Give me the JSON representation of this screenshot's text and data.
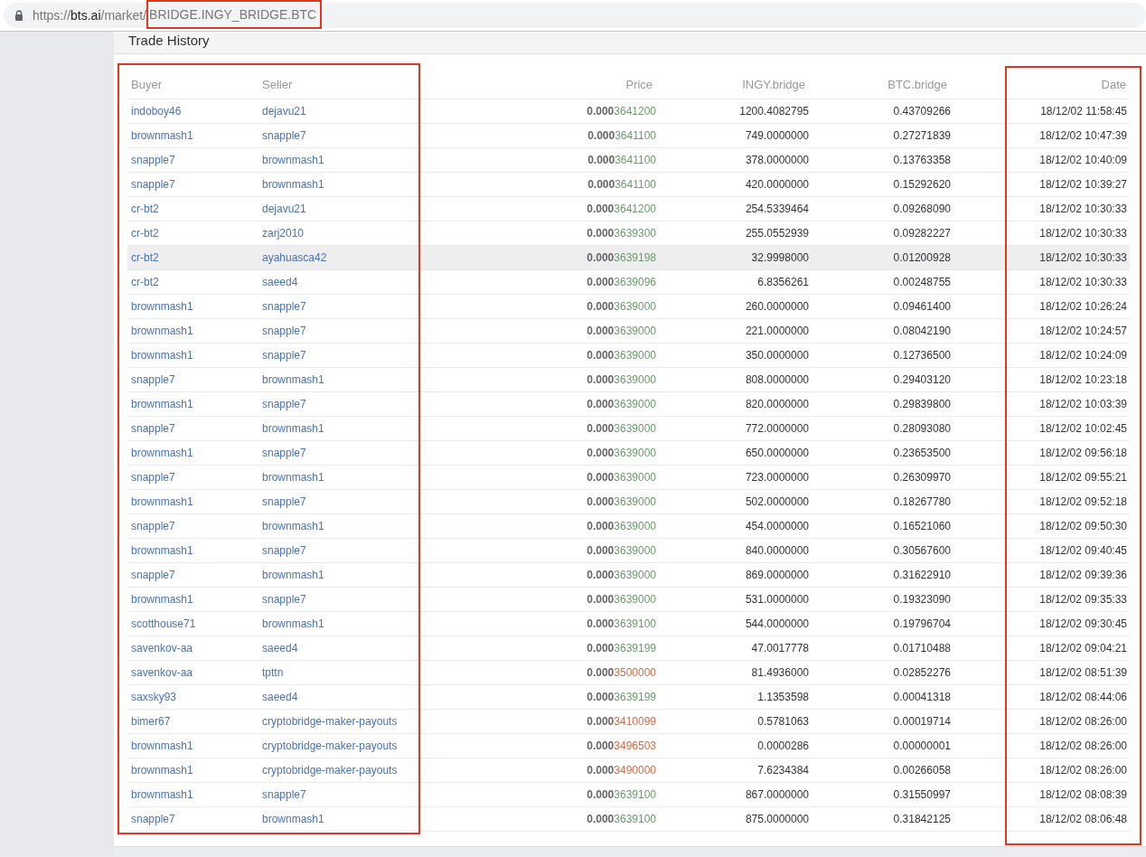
{
  "address_bar": {
    "scheme": "https://",
    "domain": "bts.ai",
    "path": "/market/",
    "market": "BRIDGE.INGY_BRIDGE.BTC",
    "market_highlighted": true
  },
  "panel": {
    "title": "Trade History"
  },
  "table": {
    "columns": [
      "Buyer",
      "Seller",
      "Price",
      "INGY.bridge",
      "BTC.bridge",
      "Date"
    ],
    "parties_outlined": true,
    "date_outlined": true,
    "rows": [
      {
        "buyer": "indoboy46",
        "seller": "dejavu21",
        "price_prefix": "0.000",
        "price_digits": "3641200",
        "color": "#6c9a6c",
        "amount": "1200.4082795",
        "total": "0.43709266",
        "date": "18/12/02 11:58:45",
        "highlighted": false
      },
      {
        "buyer": "brownmash1",
        "seller": "snapple7",
        "price_prefix": "0.000",
        "price_digits": "3641100",
        "color": "#6c9a6c",
        "amount": "749.0000000",
        "total": "0.27271839",
        "date": "18/12/02 10:47:39",
        "highlighted": false
      },
      {
        "buyer": "snapple7",
        "seller": "brownmash1",
        "price_prefix": "0.000",
        "price_digits": "3641100",
        "color": "#6c9a6c",
        "amount": "378.0000000",
        "total": "0.13763358",
        "date": "18/12/02 10:40:09",
        "highlighted": false
      },
      {
        "buyer": "snapple7",
        "seller": "brownmash1",
        "price_prefix": "0.000",
        "price_digits": "3641100",
        "color": "#6c9a6c",
        "amount": "420.0000000",
        "total": "0.15292620",
        "date": "18/12/02 10:39:27",
        "highlighted": false
      },
      {
        "buyer": "cr-bt2",
        "seller": "dejavu21",
        "price_prefix": "0.000",
        "price_digits": "3641200",
        "color": "#6c9a6c",
        "amount": "254.5339464",
        "total": "0.09268090",
        "date": "18/12/02 10:30:33",
        "highlighted": false
      },
      {
        "buyer": "cr-bt2",
        "seller": "zarj2010",
        "price_prefix": "0.000",
        "price_digits": "3639300",
        "color": "#6c9a6c",
        "amount": "255.0552939",
        "total": "0.09282227",
        "date": "18/12/02 10:30:33",
        "highlighted": false
      },
      {
        "buyer": "cr-bt2",
        "seller": "ayahuasca42",
        "price_prefix": "0.000",
        "price_digits": "3639198",
        "color": "#6c9a6c",
        "amount": "32.9998000",
        "total": "0.01200928",
        "date": "18/12/02 10:30:33",
        "highlighted": true
      },
      {
        "buyer": "cr-bt2",
        "seller": "saeed4",
        "price_prefix": "0.000",
        "price_digits": "3639096",
        "color": "#6c9a6c",
        "amount": "6.8356261",
        "total": "0.00248755",
        "date": "18/12/02 10:30:33",
        "highlighted": false
      },
      {
        "buyer": "brownmash1",
        "seller": "snapple7",
        "price_prefix": "0.000",
        "price_digits": "3639000",
        "color": "#6c9a6c",
        "amount": "260.0000000",
        "total": "0.09461400",
        "date": "18/12/02 10:26:24",
        "highlighted": false
      },
      {
        "buyer": "brownmash1",
        "seller": "snapple7",
        "price_prefix": "0.000",
        "price_digits": "3639000",
        "color": "#6c9a6c",
        "amount": "221.0000000",
        "total": "0.08042190",
        "date": "18/12/02 10:24:57",
        "highlighted": false
      },
      {
        "buyer": "brownmash1",
        "seller": "snapple7",
        "price_prefix": "0.000",
        "price_digits": "3639000",
        "color": "#6c9a6c",
        "amount": "350.0000000",
        "total": "0.12736500",
        "date": "18/12/02 10:24:09",
        "highlighted": false
      },
      {
        "buyer": "snapple7",
        "seller": "brownmash1",
        "price_prefix": "0.000",
        "price_digits": "3639000",
        "color": "#6c9a6c",
        "amount": "808.0000000",
        "total": "0.29403120",
        "date": "18/12/02 10:23:18",
        "highlighted": false
      },
      {
        "buyer": "brownmash1",
        "seller": "snapple7",
        "price_prefix": "0.000",
        "price_digits": "3639000",
        "color": "#6c9a6c",
        "amount": "820.0000000",
        "total": "0.29839800",
        "date": "18/12/02 10:03:39",
        "highlighted": false
      },
      {
        "buyer": "snapple7",
        "seller": "brownmash1",
        "price_prefix": "0.000",
        "price_digits": "3639000",
        "color": "#6c9a6c",
        "amount": "772.0000000",
        "total": "0.28093080",
        "date": "18/12/02 10:02:45",
        "highlighted": false
      },
      {
        "buyer": "brownmash1",
        "seller": "snapple7",
        "price_prefix": "0.000",
        "price_digits": "3639000",
        "color": "#6c9a6c",
        "amount": "650.0000000",
        "total": "0.23653500",
        "date": "18/12/02 09:56:18",
        "highlighted": false
      },
      {
        "buyer": "snapple7",
        "seller": "brownmash1",
        "price_prefix": "0.000",
        "price_digits": "3639000",
        "color": "#6c9a6c",
        "amount": "723.0000000",
        "total": "0.26309970",
        "date": "18/12/02 09:55:21",
        "highlighted": false
      },
      {
        "buyer": "brownmash1",
        "seller": "snapple7",
        "price_prefix": "0.000",
        "price_digits": "3639000",
        "color": "#6c9a6c",
        "amount": "502.0000000",
        "total": "0.18267780",
        "date": "18/12/02 09:52:18",
        "highlighted": false
      },
      {
        "buyer": "snapple7",
        "seller": "brownmash1",
        "price_prefix": "0.000",
        "price_digits": "3639000",
        "color": "#6c9a6c",
        "amount": "454.0000000",
        "total": "0.16521060",
        "date": "18/12/02 09:50:30",
        "highlighted": false
      },
      {
        "buyer": "brownmash1",
        "seller": "snapple7",
        "price_prefix": "0.000",
        "price_digits": "3639000",
        "color": "#6c9a6c",
        "amount": "840.0000000",
        "total": "0.30567600",
        "date": "18/12/02 09:40:45",
        "highlighted": false
      },
      {
        "buyer": "snapple7",
        "seller": "brownmash1",
        "price_prefix": "0.000",
        "price_digits": "3639000",
        "color": "#6c9a6c",
        "amount": "869.0000000",
        "total": "0.31622910",
        "date": "18/12/02 09:39:36",
        "highlighted": false
      },
      {
        "buyer": "brownmash1",
        "seller": "snapple7",
        "price_prefix": "0.000",
        "price_digits": "3639000",
        "color": "#6c9a6c",
        "amount": "531.0000000",
        "total": "0.19323090",
        "date": "18/12/02 09:35:33",
        "highlighted": false
      },
      {
        "buyer": "scotthouse71",
        "seller": "brownmash1",
        "price_prefix": "0.000",
        "price_digits": "3639100",
        "color": "#6c9a6c",
        "amount": "544.0000000",
        "total": "0.19796704",
        "date": "18/12/02 09:30:45",
        "highlighted": false
      },
      {
        "buyer": "savenkov-aa",
        "seller": "saeed4",
        "price_prefix": "0.000",
        "price_digits": "3639199",
        "color": "#6c9a6c",
        "amount": "47.0017778",
        "total": "0.01710488",
        "date": "18/12/02 09:04:21",
        "highlighted": false
      },
      {
        "buyer": "savenkov-aa",
        "seller": "tpttn",
        "price_prefix": "0.000",
        "price_digits": "3500000",
        "color": "#d0694a",
        "amount": "81.4936000",
        "total": "0.02852276",
        "date": "18/12/02 08:51:39",
        "highlighted": false
      },
      {
        "buyer": "saxsky93",
        "seller": "saeed4",
        "price_prefix": "0.000",
        "price_digits": "3639199",
        "color": "#6c9a6c",
        "amount": "1.1353598",
        "total": "0.00041318",
        "date": "18/12/02 08:44:06",
        "highlighted": false
      },
      {
        "buyer": "bimer67",
        "seller": "cryptobridge-maker-payouts",
        "price_prefix": "0.000",
        "price_digits": "3410099",
        "color": "#d0694a",
        "amount": "0.5781063",
        "total": "0.00019714",
        "date": "18/12/02 08:26:00",
        "highlighted": false
      },
      {
        "buyer": "brownmash1",
        "seller": "cryptobridge-maker-payouts",
        "price_prefix": "0.000",
        "price_digits": "3496503",
        "color": "#d0694a",
        "amount": "0.0000286",
        "total": "0.00000001",
        "date": "18/12/02 08:26:00",
        "highlighted": false
      },
      {
        "buyer": "brownmash1",
        "seller": "cryptobridge-maker-payouts",
        "price_prefix": "0.000",
        "price_digits": "3490000",
        "color": "#d0694a",
        "amount": "7.6234384",
        "total": "0.00266058",
        "date": "18/12/02 08:26:00",
        "highlighted": false
      },
      {
        "buyer": "brownmash1",
        "seller": "snapple7",
        "price_prefix": "0.000",
        "price_digits": "3639100",
        "color": "#6c9a6c",
        "amount": "867.0000000",
        "total": "0.31550997",
        "date": "18/12/02 08:08:39",
        "highlighted": false
      },
      {
        "buyer": "snapple7",
        "seller": "brownmash1",
        "price_prefix": "0.000",
        "price_digits": "3639100",
        "color": "#6c9a6c",
        "amount": "875.0000000",
        "total": "0.31842125",
        "date": "18/12/02 08:06:48",
        "highlighted": false
      }
    ]
  }
}
